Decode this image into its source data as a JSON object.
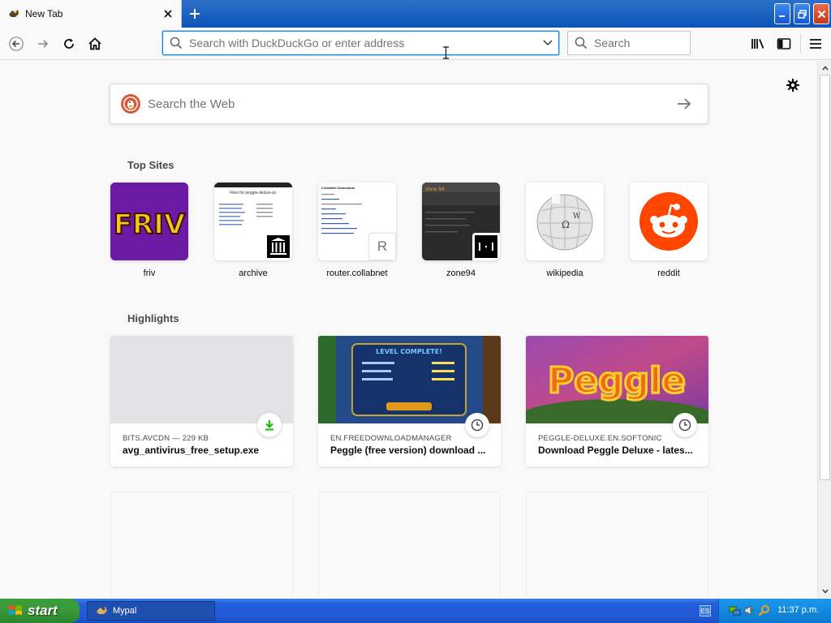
{
  "browser": {
    "tab": {
      "title": "New Tab"
    },
    "urlbar": {
      "placeholder": "Search with DuckDuckGo or enter address",
      "value": ""
    },
    "searchbar": {
      "placeholder": "Search"
    }
  },
  "newtab": {
    "websearch": {
      "placeholder": "Search the Web"
    },
    "top_sites_title": "Top Sites",
    "top_sites": [
      {
        "label": "friv"
      },
      {
        "label": "archive"
      },
      {
        "label": "router.collabnet"
      },
      {
        "label": "zone94"
      },
      {
        "label": "wikipedia"
      },
      {
        "label": "reddit"
      }
    ],
    "highlights_title": "Highlights",
    "highlights": [
      {
        "host": "BITS.AVCDN — 229 KB",
        "title": "avg_antivirus_free_setup.exe",
        "badge": "download-icon"
      },
      {
        "host": "EN.FREEDOWNLOADMANAGER",
        "title": "Peggle (free version) download ...",
        "badge": "clock-icon"
      },
      {
        "host": "PEGGLE-DELUXE.EN.SOFTONIC",
        "title": "Download Peggle Deluxe - lates...",
        "badge": "clock-icon"
      }
    ],
    "thumb_texts": {
      "friv": "FRIV",
      "archive": "Files for peggle-deluxe-pc",
      "collabnet": "CollabNet Downloads",
      "collabnet_letter": "R",
      "zone94": "zone 94",
      "peggle": "Peggle",
      "level_complete": "LEVEL COMPLETE!"
    }
  },
  "taskbar": {
    "start_label": "start",
    "task_label": "Mypal",
    "lang": "ES",
    "clock": "11:37 p.m."
  },
  "colors": {
    "accent": "#0a84ff",
    "reddit": "#ff4500",
    "friv_bg": "#6b1aa3",
    "download_green": "#12bc00"
  }
}
